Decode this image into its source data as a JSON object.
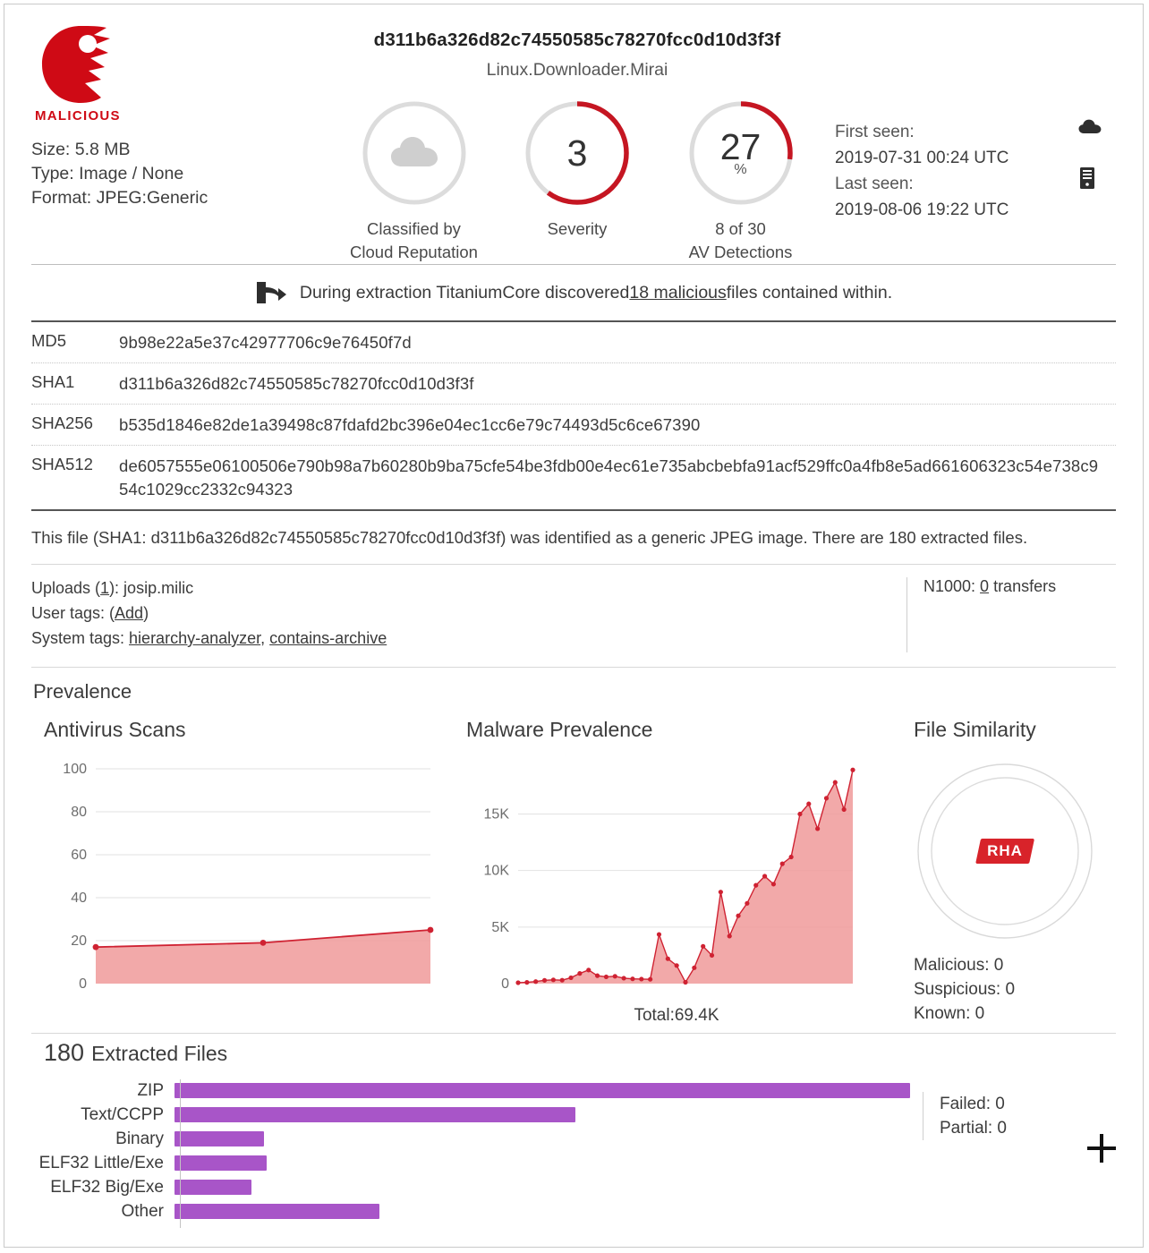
{
  "header": {
    "verdict": "MALICIOUS",
    "verdict_color": "#cf0a15",
    "file_hash_title": "d311b6a326d82c74550585c78270fcc0d10d3f3f",
    "threat_name": "Linux.Downloader.Mirai",
    "meta": {
      "size": "Size: 5.8 MB",
      "type": "Type: Image / None",
      "format": "Format: JPEG:Generic"
    },
    "gauges": [
      {
        "icon": "cloud-icon",
        "value": "",
        "percent_sign": "",
        "caption_line1": "Classified by",
        "caption_line2": "Cloud Reputation",
        "arc_percent": 0
      },
      {
        "icon": "",
        "value": "3",
        "percent_sign": "",
        "caption_line1": "Severity",
        "caption_line2": "",
        "arc_percent": 60
      },
      {
        "icon": "",
        "value": "27",
        "percent_sign": "%",
        "caption_line1": "8 of 30",
        "caption_line2": "AV Detections",
        "arc_percent": 27
      }
    ],
    "first_seen_label": "First seen:",
    "first_seen_value": "2019-07-31 00:24 UTC",
    "last_seen_label": "Last seen:",
    "last_seen_value": "2019-08-06 19:22 UTC"
  },
  "extraction_notice": {
    "prefix": "During extraction TitaniumCore discovered ",
    "link": "18 malicious",
    "suffix": " files contained within."
  },
  "hashes": [
    {
      "label": "MD5",
      "value": "9b98e22a5e37c42977706c9e76450f7d"
    },
    {
      "label": "SHA1",
      "value": "d311b6a326d82c74550585c78270fcc0d10d3f3f"
    },
    {
      "label": "SHA256",
      "value": "b535d1846e82de1a39498c87fdafd2bc396e04ec1cc6e79c74493d5c6ce67390"
    },
    {
      "label": "SHA512",
      "value": "de6057555e06100506e790b98a7b60280b9ba75cfe54be3fdb00e4ec61e735abcbebfa91acf529ffc0a4fb8e5ad661606323c54e738c954c1029cc2332c94323"
    }
  ],
  "description": "This file (SHA1: d311b6a326d82c74550585c78270fcc0d10d3f3f) was identified as a generic JPEG image. There are 180 extracted files.",
  "uploads": {
    "uploads_prefix": "Uploads (",
    "uploads_count": "1",
    "uploads_suffix": "): josip.milic",
    "user_tags_label": "User tags: (",
    "user_tags_add": "Add",
    "user_tags_close": ")",
    "system_tags_label": "System tags: ",
    "system_tag_1": "hierarchy-analyzer",
    "system_tag_sep": ", ",
    "system_tag_2": "contains-archive",
    "n1000_prefix": "N1000: ",
    "n1000_count": "0",
    "n1000_suffix": " transfers"
  },
  "prevalence_title": "Prevalence",
  "similarity": {
    "title": "File Similarity",
    "badge": "RHA",
    "malicious": "Malicious: 0",
    "suspicious": "Suspicious: 0",
    "known": "Known: 0"
  },
  "extracted": {
    "count": "180",
    "word": "Extracted Files",
    "failed": "Failed: 0",
    "partial": "Partial: 0"
  },
  "chart_data": [
    {
      "type": "area",
      "title": "Antivirus Scans",
      "xlabel": "",
      "ylabel": "",
      "ylim": [
        0,
        100
      ],
      "yticks": [
        0,
        20,
        40,
        60,
        80,
        100
      ],
      "ytick_labels": [
        "0",
        "20",
        "40",
        "60",
        "80",
        "100"
      ],
      "grid": true,
      "legend": "none",
      "line_color": "#cf2232",
      "fill_color": "#f09a9a",
      "x": [
        0,
        1,
        2
      ],
      "values": [
        17,
        19,
        25
      ]
    },
    {
      "type": "area",
      "title": "Malware Prevalence",
      "xlabel": "",
      "ylabel": "",
      "ylim": [
        0,
        19000
      ],
      "yticks": [
        0,
        5000,
        10000,
        15000
      ],
      "ytick_labels": [
        "0",
        "5K",
        "10K",
        "15K"
      ],
      "grid": true,
      "legend": "none",
      "annotation": "Total:69.4K",
      "line_color": "#cf2232",
      "fill_color": "#f09a9a",
      "values": [
        80,
        110,
        180,
        290,
        330,
        300,
        520,
        900,
        1200,
        700,
        600,
        650,
        480,
        420,
        400,
        380,
        4350,
        2200,
        1600,
        120,
        1400,
        3300,
        2500,
        8100,
        4200,
        6000,
        7100,
        8700,
        9500,
        8800,
        10600,
        11200,
        15000,
        15900,
        13700,
        16400,
        17800,
        15400,
        18900
      ]
    },
    {
      "type": "bar",
      "orientation": "horizontal",
      "title": "180 Extracted Files",
      "categories": [
        "ZIP",
        "Text/CCPP",
        "Binary",
        "ELF32 Little/Exe",
        "ELF32 Big/Exe",
        "Other"
      ],
      "values": [
        100,
        54.5,
        12.2,
        12.5,
        10.5,
        27.8
      ],
      "xlim": [
        0,
        100
      ],
      "grid": false,
      "legend": "none",
      "bar_color": "#a855c8"
    }
  ]
}
